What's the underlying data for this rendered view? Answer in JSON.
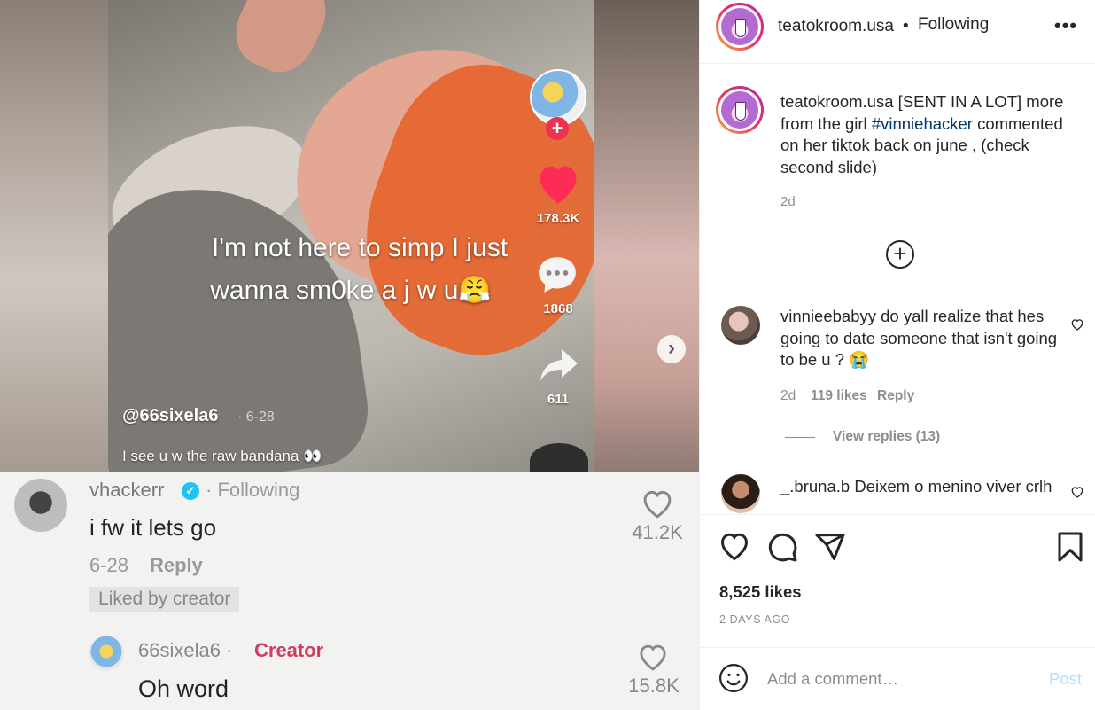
{
  "media": {
    "caption_line1": "I'm not here to simp I just",
    "caption_line2": "wanna sm0ke a j w u😤",
    "tiktok_username": "@66sixela6",
    "tiktok_date": "· 6-28",
    "tiktok_description": "I see u w the raw bandana 👀",
    "like_count": "178.3K",
    "comment_count": "1868",
    "share_count": "611",
    "next_arrow": "›"
  },
  "tiktok_comments": {
    "first": {
      "username": "vhackerr",
      "verified_glyph": "✓",
      "follow_status": "· Following",
      "text": "i fw it lets go",
      "date": "6-28",
      "reply_label": "Reply",
      "liked_by_creator": "Liked by creator",
      "likes": "41.2K"
    },
    "second": {
      "username": "66sixela6 ·",
      "creator_label": "Creator",
      "text": "Oh word",
      "likes": "15.8K"
    }
  },
  "header": {
    "username": "teatokroom.usa",
    "separator": "•",
    "follow_status": "Following",
    "more": "•••"
  },
  "caption": {
    "username": "teatokroom.usa",
    "text_before": " [SENT IN A LOT] more from the girl ",
    "hashtag": "#vinniehacker",
    "text_after": " commented on her tiktok back on june , (check second slide)",
    "time": "2d"
  },
  "load_more": "+",
  "comments": [
    {
      "username": "vinnieebabyy",
      "text": " do yall realize that hes going to date someone that isn't going to be u ? 😭",
      "time": "2d",
      "likes": "119 likes",
      "reply": "Reply",
      "view_replies": "View replies (13)"
    },
    {
      "username": "_.bruna.b",
      "text": " Deixem o menino viver crlh"
    }
  ],
  "actions": {
    "likes": "8,525 likes",
    "age": "2 DAYS AGO"
  },
  "add_comment": {
    "placeholder": "Add a comment…",
    "post_label": "Post"
  },
  "icons": [
    "heart-icon",
    "comment-icon",
    "share-icon",
    "bookmark-icon",
    "emoji-icon",
    "plus-circle-icon",
    "more-icon",
    "chevron-right-icon"
  ],
  "colors": {
    "tiktok_red": "#fe2c55",
    "link_blue": "#00376b",
    "post_disabled": "#b2dffc",
    "creator_pink": "#d23c5f"
  }
}
